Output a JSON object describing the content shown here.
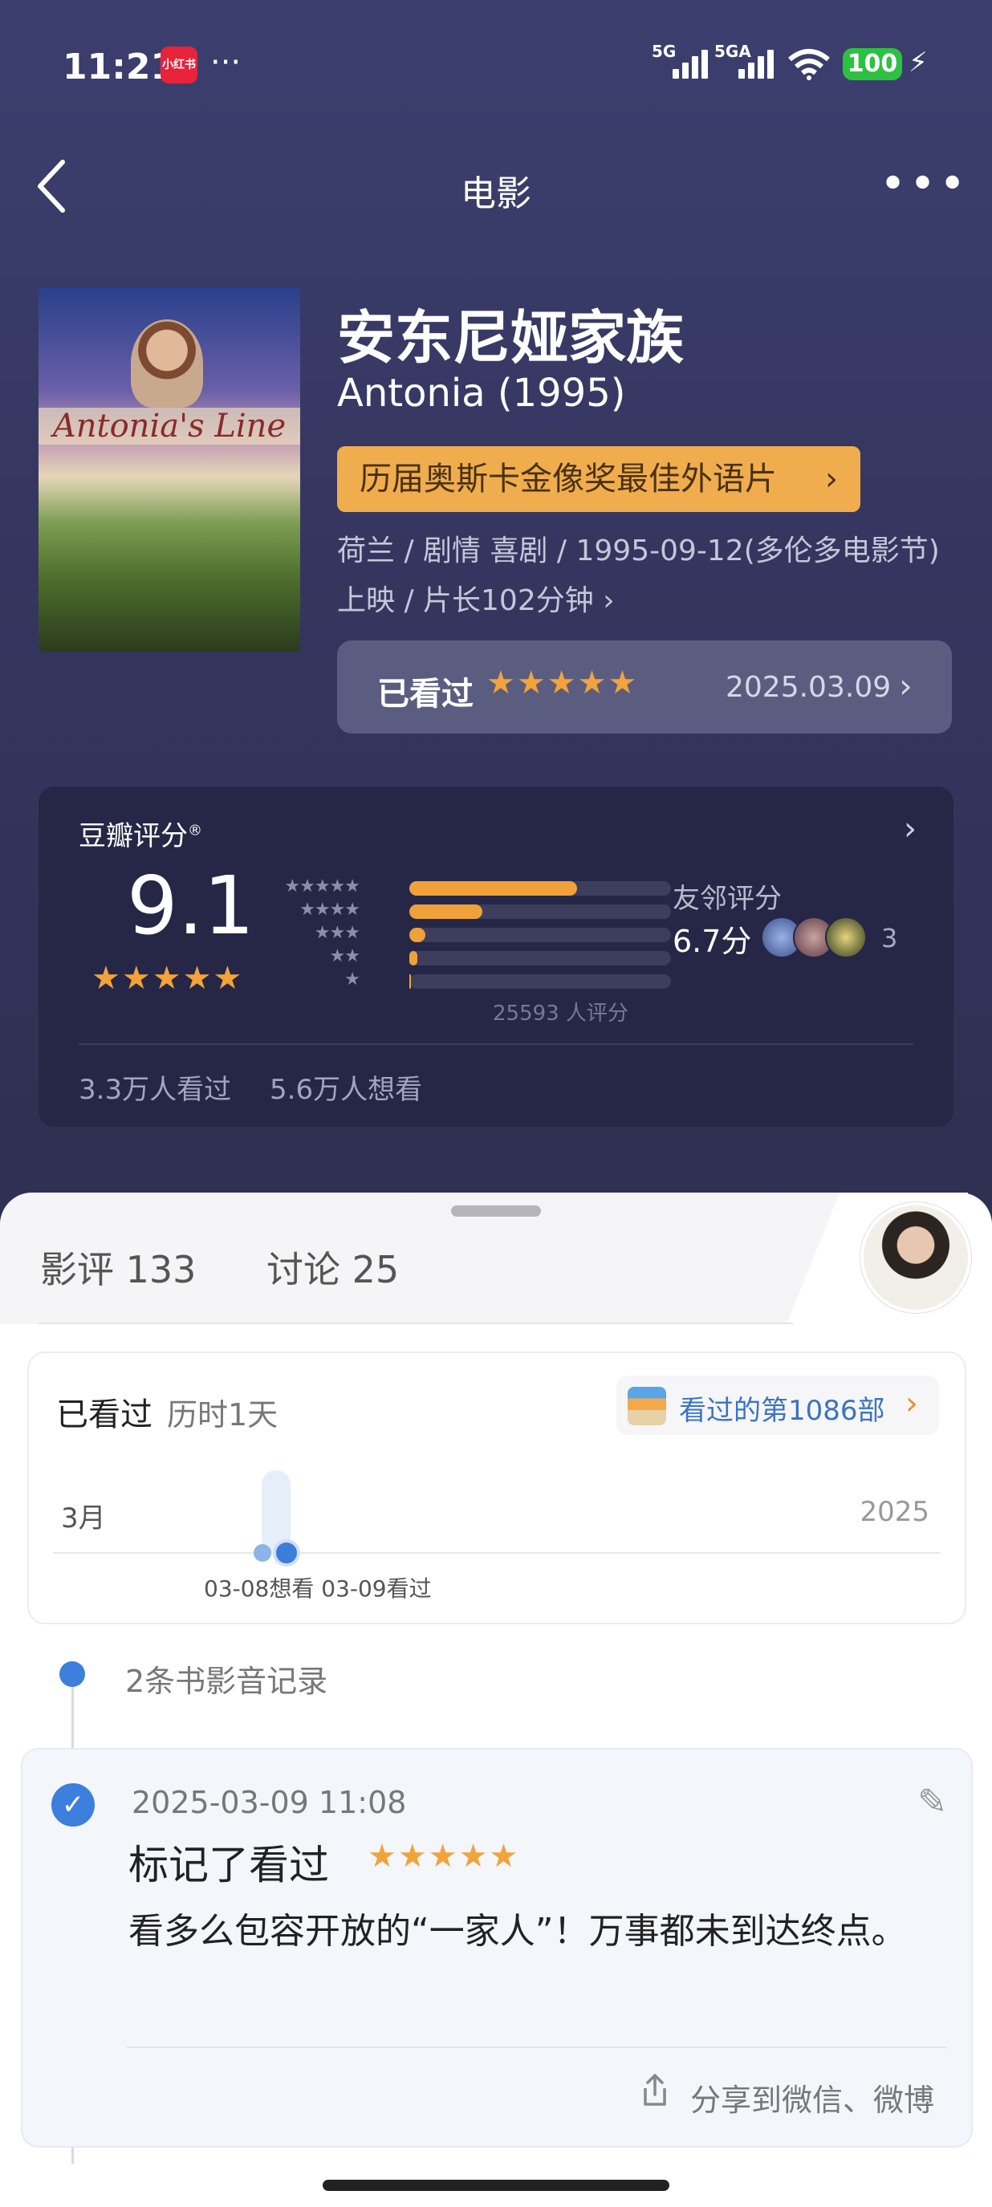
{
  "status_bar": {
    "time": "11:21",
    "app_badge": "小红书",
    "more": "···",
    "signal1": "5G",
    "signal2": "5GA",
    "battery": "100"
  },
  "nav": {
    "title": "电影",
    "more": "•••"
  },
  "movie": {
    "poster_text": "Antonia's Line",
    "title_cn": "安东尼娅家族",
    "title_en": "Antonia (1995)",
    "award": "历届奥斯卡金像奖最佳外语片",
    "meta": "荷兰 / 剧情 喜剧 / 1995-09-12(多伦多电影节)上映 / 片长102分钟",
    "watched_label": "已看过",
    "watched_stars": "★★★★★",
    "watched_date": "2025.03.09"
  },
  "rating": {
    "title": "豆瓣评分",
    "title_mark": "®",
    "score": "9.1",
    "score_stars": "★★★★★",
    "distribution": [
      {
        "stars": "★★★★★",
        "fraction": 0.64
      },
      {
        "stars": "★★★★",
        "fraction": 0.28
      },
      {
        "stars": "★★★",
        "fraction": 0.06
      },
      {
        "stars": "★★",
        "fraction": 0.01
      },
      {
        "stars": "★",
        "fraction": 0.0
      }
    ],
    "votes": "25593 人评分",
    "friend_label": "友邻评分",
    "friend_score": "6.7分",
    "friend_count": "3",
    "seen": "3.3万人看过",
    "want": "5.6万人想看"
  },
  "tabs": [
    {
      "label": "影评 133"
    },
    {
      "label": "讨论 25"
    }
  ],
  "watch_card": {
    "title": "已看过",
    "duration": "历时1天",
    "badge": "看过的第1086部",
    "month": "3月",
    "year": "2025",
    "dates": "03-08想看 03-09看过"
  },
  "timeline": {
    "count": "2条书影音记录"
  },
  "record": {
    "date": "2025-03-09 11:08",
    "mark": "标记了看过",
    "stars": "★★★★★",
    "text": "看多么包容开放的“一家人”！万事都未到达终点。",
    "share": "分享到微信、微博"
  },
  "colors": {
    "accent_orange": "#f0a13a",
    "hero_bg": "#3c3f6e",
    "blue": "#3d7fdd"
  }
}
